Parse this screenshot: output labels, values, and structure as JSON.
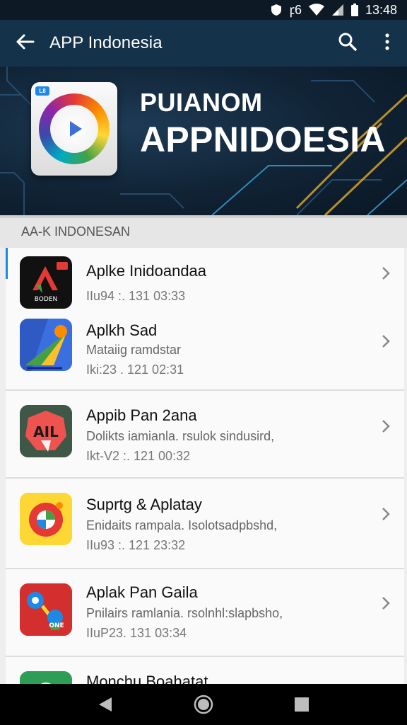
{
  "status_bar": {
    "network": "ꝼ6",
    "time": "13:48"
  },
  "app_bar": {
    "title": "APP Indonesia"
  },
  "banner": {
    "headline_1": "PUIANOM",
    "headline_2": "APPNIDOESIA",
    "tile_badge": "L8"
  },
  "section": {
    "title": "AA-K INDONESAN"
  },
  "apps": [
    {
      "title": "Aplke Inidoandaa",
      "subtitle": "",
      "meta": "IIu94 :. 131 03:33",
      "icon": "red-a-logo-icon",
      "icon_text": "BODEN"
    },
    {
      "title": "Aplkh Sad",
      "subtitle": "Mataiig ramdstar",
      "meta": "Iki:23 . 121 02:31",
      "icon": "blue-paper-plane-icon",
      "icon_text": ""
    },
    {
      "title": "Appib Pan 2ana",
      "subtitle": "Dolikts iamianla. rsulok sindusird,",
      "meta": "Ikt-V2 :. 121 00:32",
      "icon": "ail-badge-icon",
      "icon_text": "AIL"
    },
    {
      "title": "Suprtg & Aplatay",
      "subtitle": "Enidaits rampala. Isolotsadpbshd,",
      "meta": "IIu93 :. 121 23:32",
      "icon": "ring-camera-icon",
      "icon_text": ""
    },
    {
      "title": "Aplak Pan Gaila",
      "subtitle": "Pnilairs ramlania. rsolnhl:slapbsho,",
      "meta": "IIuP23. 131 03:34",
      "icon": "map-pin-icon",
      "icon_text": "ONE"
    },
    {
      "title": "Monchu Boahatat",
      "subtitle": "",
      "meta": "",
      "icon": "green-circle-icon",
      "icon_text": ""
    }
  ],
  "colors": {
    "app_bar": "#14324a",
    "accent": "#1e88e5",
    "list_bg": "#fafafa"
  }
}
